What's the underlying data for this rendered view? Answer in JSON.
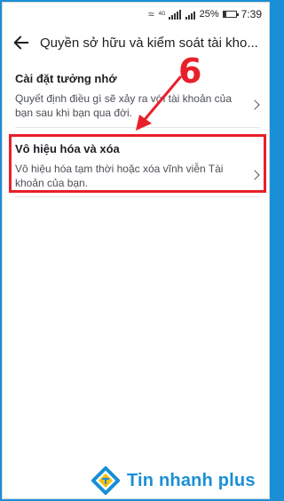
{
  "status_bar": {
    "network_label": "4G",
    "battery": "25%",
    "time": "7:39"
  },
  "header": {
    "title": "Quyền sở hữu và kiểm soát tài kho..."
  },
  "items": [
    {
      "title": "Cài đặt tưởng nhớ",
      "description": "Quyết định điều gì sẽ xảy ra với tài khoản của bạn sau khi bạn qua đời."
    },
    {
      "title": "Vô hiệu hóa và xóa",
      "description": "Vô hiệu hóa tạm thời hoặc xóa vĩnh viễn Tài khoản của bạn."
    }
  ],
  "annotation": {
    "step_number": "6",
    "color": "#e8202a"
  },
  "watermark": {
    "text": "Tin nhanh plus"
  }
}
